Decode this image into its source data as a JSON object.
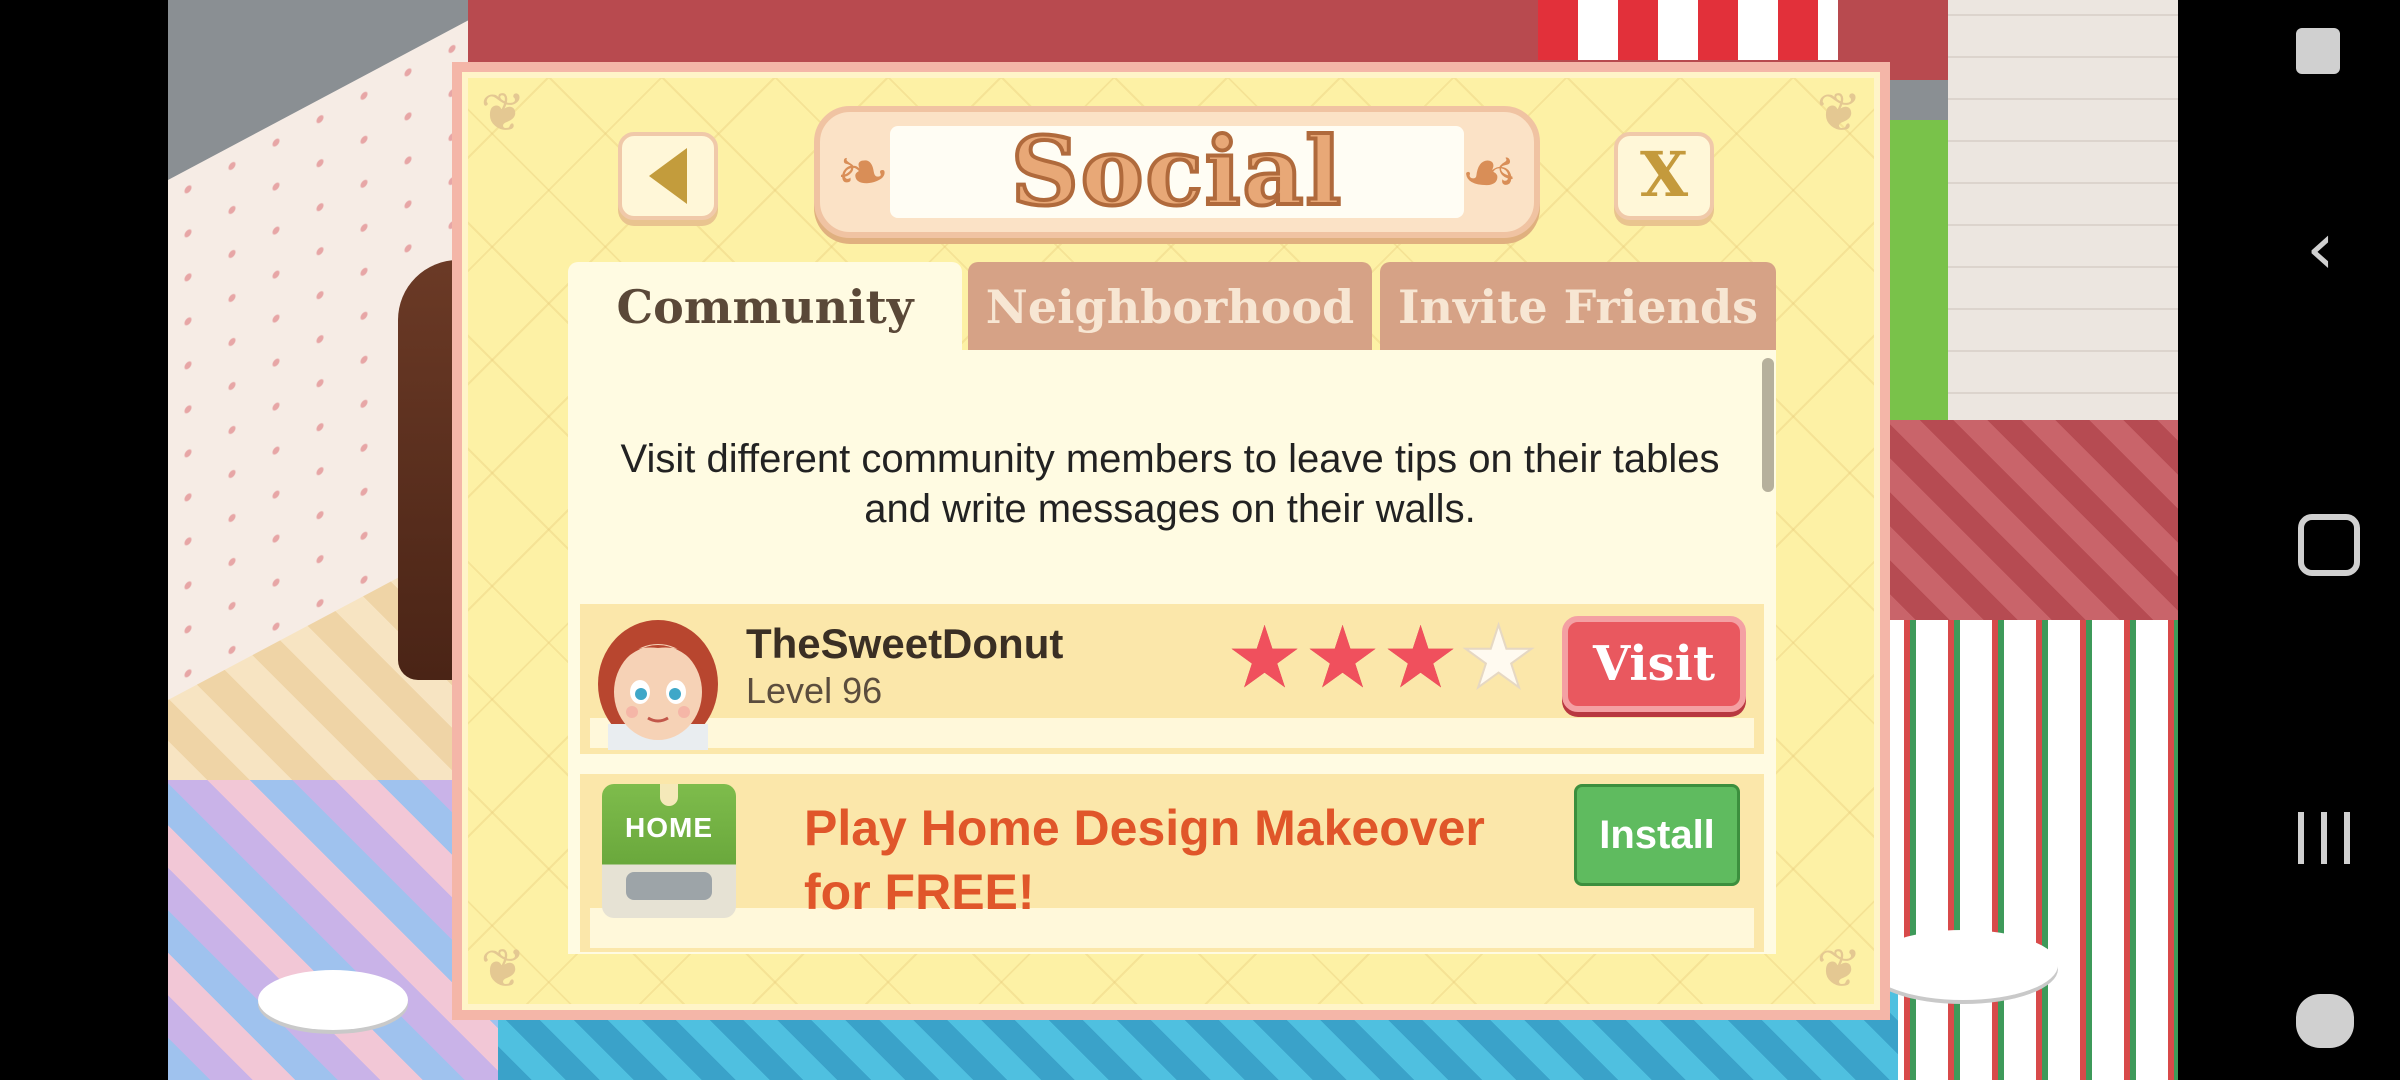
{
  "dialog": {
    "title": "Social",
    "close_label": "X"
  },
  "tabs": [
    {
      "label": "Community",
      "active": true
    },
    {
      "label": "Neighborhood",
      "active": false
    },
    {
      "label": "Invite Friends",
      "active": false
    }
  ],
  "intro_text": "Visit different community members to leave tips on their tables and write messages on their walls.",
  "member": {
    "name": "TheSweetDonut",
    "level": "Level 96",
    "rating": 3,
    "rating_max": 4,
    "visit_label": "Visit"
  },
  "ad": {
    "icon_text": "HOME",
    "text": "Play Home Design Makeover for FREE!",
    "button_label": "Install"
  },
  "colors": {
    "dialog_bg": "#fdf1a5",
    "active_tab": "#fffbe2",
    "inactive_tab": "#d6a286",
    "visit_button": "#e9585f",
    "install_button": "#5fbb5f",
    "ad_text": "#e0562a"
  },
  "system_nav": {
    "icons": [
      "screen-pin-icon",
      "back-icon",
      "home-icon",
      "recents-icon",
      "game-tools-icon"
    ]
  }
}
